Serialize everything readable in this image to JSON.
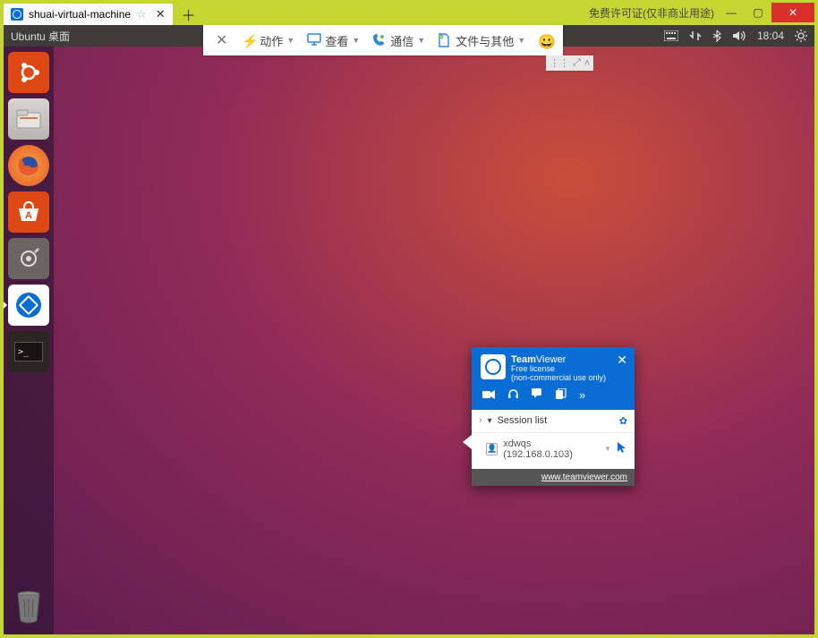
{
  "window": {
    "tab_title": "shuai-virtual-machine",
    "license_text": "免费许可证(仅非商业用途)"
  },
  "menubar": {
    "label": "Ubuntu 桌面",
    "time": "18:04"
  },
  "tv_toolbar": {
    "action": "动作",
    "view": "查看",
    "comm": "通信",
    "files": "文件与其他"
  },
  "tvpanel": {
    "brand_team": "Team",
    "brand_viewer": "Viewer",
    "license1": "Free license",
    "license2": "(non-commercial use only)",
    "session_header": "Session list",
    "entry_name": "xdwqs (192.168.0.103)",
    "footer": "www.teamviewer.com"
  }
}
